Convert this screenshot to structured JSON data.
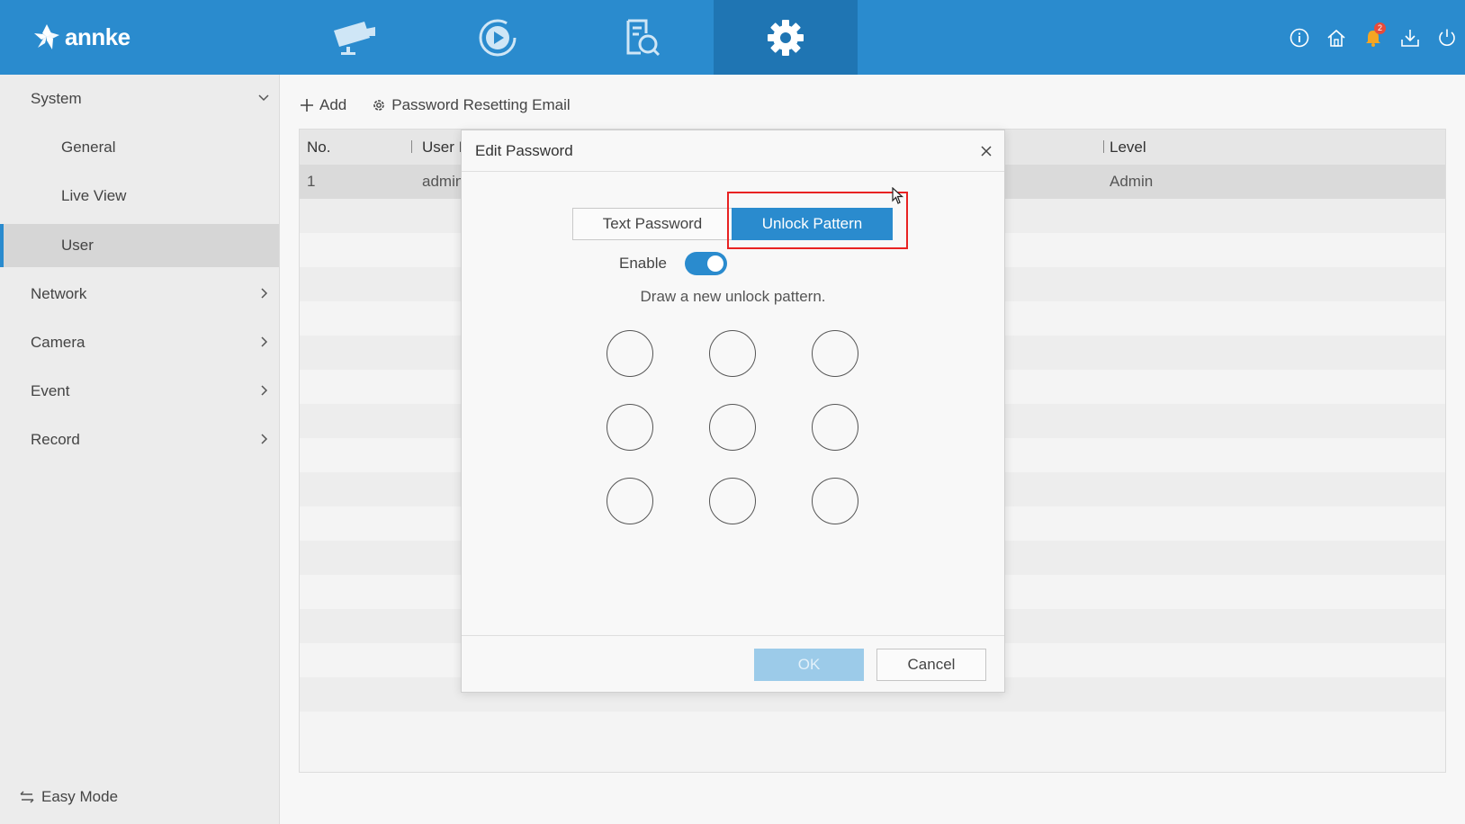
{
  "app": {
    "brand": "annke"
  },
  "topnav": {
    "items": [
      {
        "name": "live-view",
        "icon": "camera-icon"
      },
      {
        "name": "playback",
        "icon": "playback-icon"
      },
      {
        "name": "search",
        "icon": "file-search-icon"
      },
      {
        "name": "configuration",
        "icon": "gear-icon",
        "active": true
      }
    ],
    "notifications_count": "2",
    "right_icons": [
      "info-icon",
      "home-icon",
      "bell-icon",
      "download-icon",
      "power-icon"
    ]
  },
  "sidebar": {
    "items": [
      {
        "label": "System",
        "expanded": true
      },
      {
        "label": "General",
        "sub": true
      },
      {
        "label": "Live View",
        "sub": true
      },
      {
        "label": "User",
        "sub": true,
        "selected": true
      },
      {
        "label": "Network"
      },
      {
        "label": "Camera"
      },
      {
        "label": "Event"
      },
      {
        "label": "Record"
      }
    ],
    "easy_mode": "Easy Mode"
  },
  "toolbar": {
    "add_label": "Add",
    "reset_email_label": "Password Resetting Email"
  },
  "table": {
    "columns": [
      "No.",
      "User I",
      "Level"
    ],
    "rows": [
      {
        "no": "1",
        "user": "admin",
        "level": "Admin"
      }
    ]
  },
  "dialog": {
    "title": "Edit Password",
    "tab_text": "Text Password",
    "tab_pattern": "Unlock Pattern",
    "enable_label": "Enable",
    "enable_state": true,
    "hint": "Draw a new unlock pattern.",
    "ok_label": "OK",
    "cancel_label": "Cancel"
  },
  "colors": {
    "accent": "#2a8bce",
    "highlight": "#e82222",
    "badge": "#e84b3a"
  }
}
